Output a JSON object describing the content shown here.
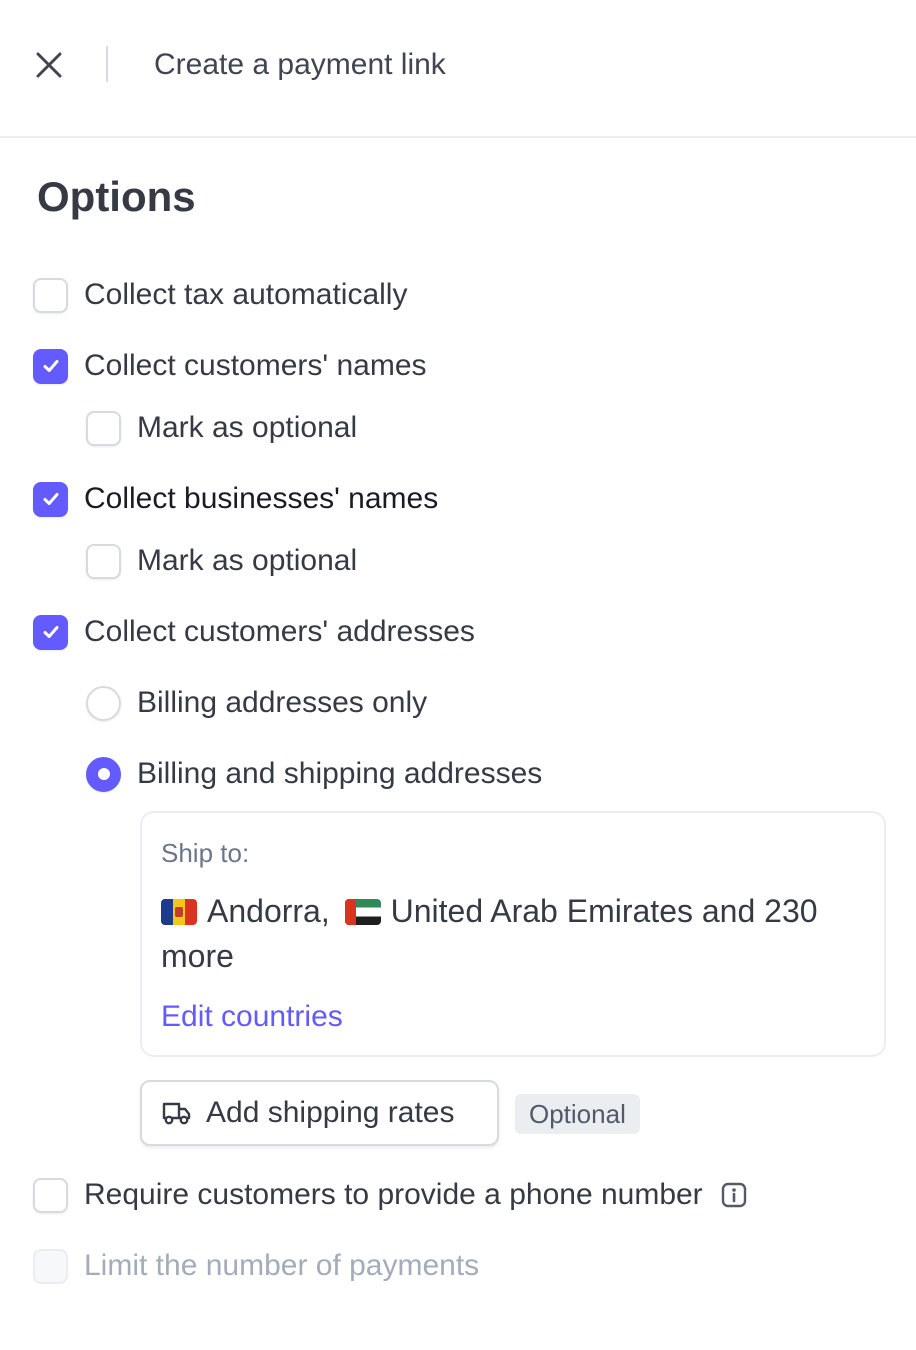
{
  "header": {
    "title": "Create a payment link",
    "close_icon": "close-icon"
  },
  "section": {
    "title": "Options"
  },
  "options": {
    "collect_tax": {
      "label": "Collect tax automatically",
      "checked": false
    },
    "customer_names": {
      "label": "Collect customers' names",
      "checked": true,
      "optional_label": "Mark as optional",
      "optional_checked": false
    },
    "business_names": {
      "label": "Collect businesses' names",
      "checked": true,
      "optional_label": "Mark as optional",
      "optional_checked": false
    },
    "addresses": {
      "label": "Collect customers' addresses",
      "checked": true,
      "radio_billing": "Billing addresses only",
      "radio_billing_shipping": "Billing and shipping addresses",
      "selected": "billing_shipping"
    },
    "phone": {
      "label": "Require customers to provide a phone number",
      "checked": false,
      "info_icon": "info-icon"
    },
    "limit_payments": {
      "label": "Limit the number of payments",
      "checked": false,
      "disabled": true
    }
  },
  "shipping": {
    "ship_to_label": "Ship to:",
    "country1": "Andorra,",
    "country2": "United Arab Emirates and 230 more",
    "edit_link": "Edit countries",
    "add_rates_label": "Add shipping rates",
    "optional_badge": "Optional",
    "truck_icon": "truck-icon"
  },
  "colors": {
    "accent": "#635bff",
    "text": "#353a44",
    "muted": "#a3acba",
    "border": "#d5dbe1"
  }
}
